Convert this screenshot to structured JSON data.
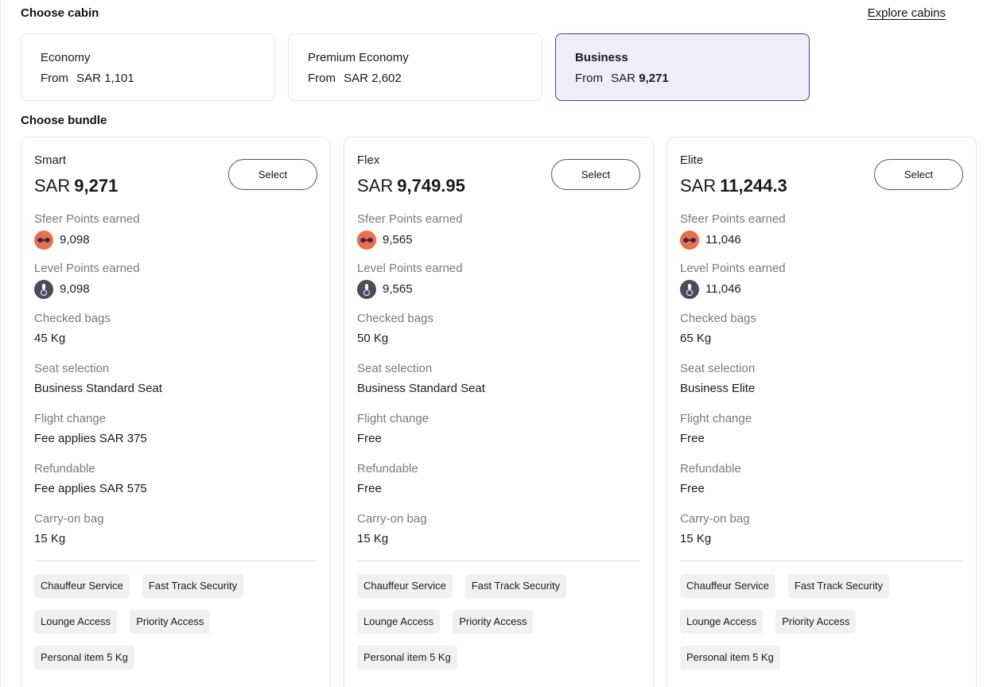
{
  "headings": {
    "choose_cabin": "Choose cabin",
    "explore_cabins": "Explore cabins",
    "choose_bundle": "Choose bundle"
  },
  "cabins": [
    {
      "name": "Economy",
      "from": "From",
      "currency": "SAR",
      "amount": "1,101",
      "selected": false
    },
    {
      "name": "Premium Economy",
      "from": "From",
      "currency": "SAR",
      "amount": "2,602",
      "selected": false
    },
    {
      "name": "Business",
      "from": "From",
      "currency": "SAR",
      "amount": "9,271",
      "selected": true
    }
  ],
  "labels": {
    "select": "Select",
    "sfeer_points": "Sfeer Points earned",
    "level_points": "Level Points earned",
    "checked_bags": "Checked bags",
    "seat_selection": "Seat selection",
    "flight_change": "Flight change",
    "refundable": "Refundable",
    "carry_on": "Carry-on bag"
  },
  "bundles": [
    {
      "name": "Smart",
      "currency": "SAR",
      "price": "9,271",
      "sfeer_points": "9,098",
      "level_points": "9,098",
      "checked_bags": "45 Kg",
      "seat_selection": "Business Standard Seat",
      "flight_change": "Fee applies SAR 375",
      "refundable": "Fee applies SAR 575",
      "carry_on": "15 Kg",
      "perks": [
        "Chauffeur Service",
        "Fast Track Security",
        "Lounge Access",
        "Priority Access",
        "Personal item 5 Kg"
      ]
    },
    {
      "name": "Flex",
      "currency": "SAR",
      "price": "9,749.95",
      "sfeer_points": "9,565",
      "level_points": "9,565",
      "checked_bags": "50 Kg",
      "seat_selection": "Business Standard Seat",
      "flight_change": "Free",
      "refundable": "Free",
      "carry_on": "15 Kg",
      "perks": [
        "Chauffeur Service",
        "Fast Track Security",
        "Lounge Access",
        "Priority Access",
        "Personal item 5 Kg"
      ]
    },
    {
      "name": "Elite",
      "currency": "SAR",
      "price": "11,244.3",
      "sfeer_points": "11,046",
      "level_points": "11,046",
      "checked_bags": "65 Kg",
      "seat_selection": "Business Elite",
      "flight_change": "Free",
      "refundable": "Free",
      "carry_on": "15 Kg",
      "perks": [
        "Chauffeur Service",
        "Fast Track Security",
        "Lounge Access",
        "Priority Access",
        "Personal item 5 Kg"
      ]
    }
  ],
  "icons": {
    "sfeer": "sfeer-points-icon",
    "level": "level-points-icon"
  },
  "colors": {
    "selected_border": "#4b3f8f",
    "selected_bg": "#eeeefb",
    "sfeer_icon": "#e8714a",
    "level_icon": "#4d4a5c"
  }
}
